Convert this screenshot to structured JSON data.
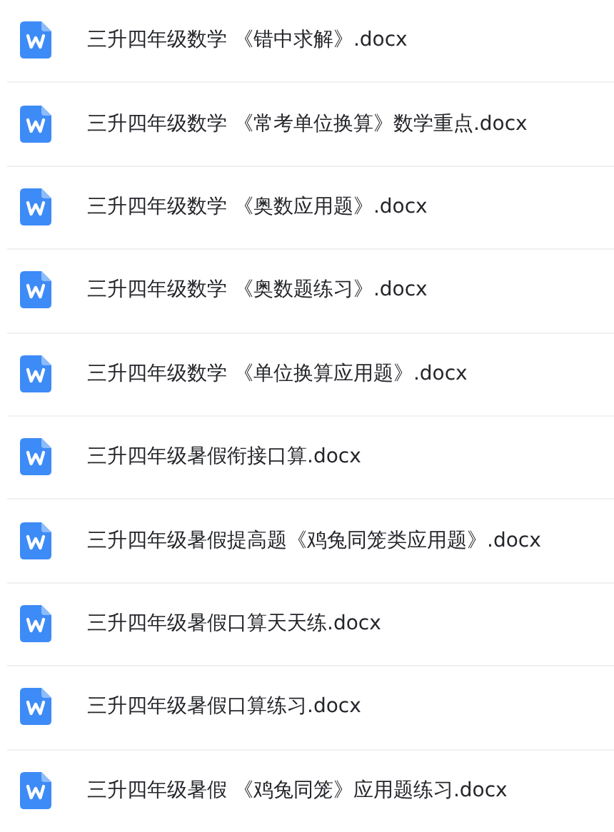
{
  "files": [
    {
      "name": "三升四年级数学 《错中求解》.docx"
    },
    {
      "name": "三升四年级数学 《常考单位换算》数学重点.docx"
    },
    {
      "name": "三升四年级数学 《奥数应用题》.docx"
    },
    {
      "name": "三升四年级数学 《奥数题练习》.docx"
    },
    {
      "name": "三升四年级数学 《单位换算应用题》.docx"
    },
    {
      "name": "三升四年级暑假衔接口算.docx"
    },
    {
      "name": "三升四年级暑假提高题《鸡兔同笼类应用题》.docx"
    },
    {
      "name": "三升四年级暑假口算天天练.docx"
    },
    {
      "name": "三升四年级暑假口算练习.docx"
    },
    {
      "name": "三升四年级暑假 《鸡兔同笼》应用题练习.docx"
    }
  ]
}
